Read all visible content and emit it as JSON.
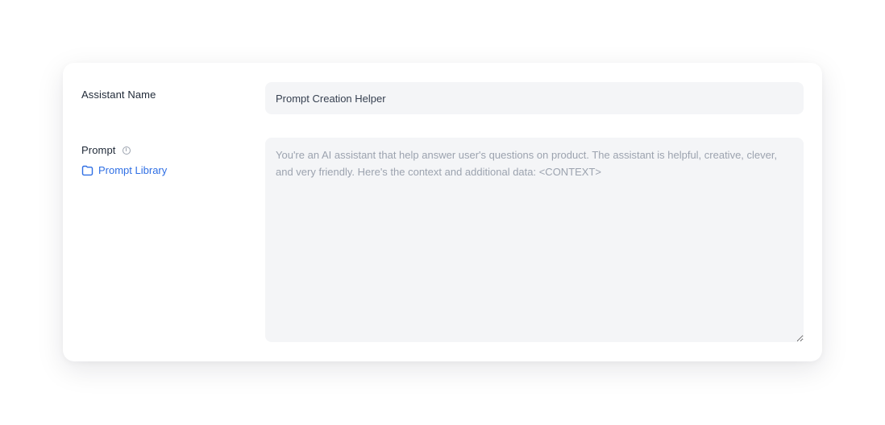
{
  "form": {
    "assistant_name_label": "Assistant Name",
    "assistant_name_value": "Prompt Creation Helper",
    "prompt_label": "Prompt",
    "prompt_info_icon": "info-circle-icon",
    "prompt_library_label": "Prompt Library",
    "prompt_library_icon": "folder-icon",
    "prompt_placeholder": "You're an AI assistant that help answer user's questions on product. The assistant is helpful, creative, clever, and very friendly. Here's the context and additional data: <CONTEXT>",
    "prompt_value": ""
  },
  "colors": {
    "link": "#2f6fe4",
    "field_background": "#f4f5f7",
    "placeholder_text": "#9ca3af",
    "label_text": "#1f2937"
  }
}
